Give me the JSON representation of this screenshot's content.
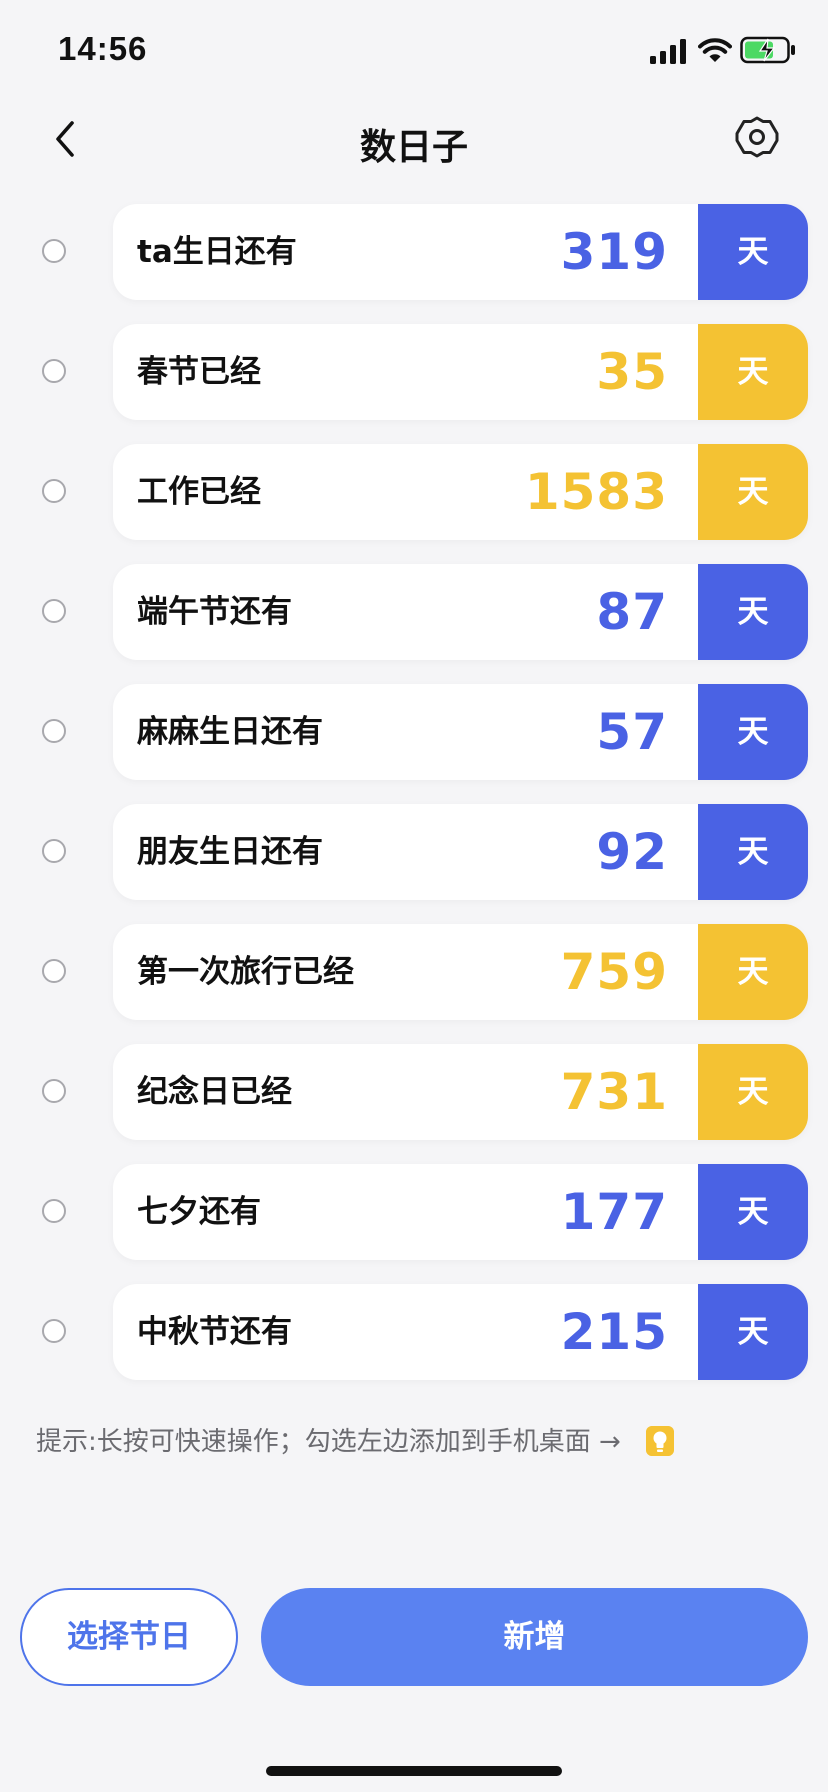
{
  "status_bar": {
    "time": "14:56"
  },
  "nav": {
    "title": "数日子"
  },
  "colors": {
    "blue": "#4a62e4",
    "yellow": "#f4c233"
  },
  "items": [
    {
      "label": "ta生日还有",
      "days": "319",
      "unit": "天",
      "color": "blue"
    },
    {
      "label": "春节已经",
      "days": "35",
      "unit": "天",
      "color": "yellow"
    },
    {
      "label": "工作已经",
      "days": "1583",
      "unit": "天",
      "color": "yellow"
    },
    {
      "label": "端午节还有",
      "days": "87",
      "unit": "天",
      "color": "blue"
    },
    {
      "label": "麻麻生日还有",
      "days": "57",
      "unit": "天",
      "color": "blue"
    },
    {
      "label": "朋友生日还有",
      "days": "92",
      "unit": "天",
      "color": "blue"
    },
    {
      "label": "第一次旅行已经",
      "days": "759",
      "unit": "天",
      "color": "yellow"
    },
    {
      "label": "纪念日已经",
      "days": "731",
      "unit": "天",
      "color": "yellow"
    },
    {
      "label": "七夕还有",
      "days": "177",
      "unit": "天",
      "color": "blue"
    },
    {
      "label": "中秋节还有",
      "days": "215",
      "unit": "天",
      "color": "blue"
    }
  ],
  "hint": "提示:长按可快速操作；勾选左边添加到手机桌面 →",
  "buttons": {
    "select": "选择节日",
    "add": "新增"
  }
}
